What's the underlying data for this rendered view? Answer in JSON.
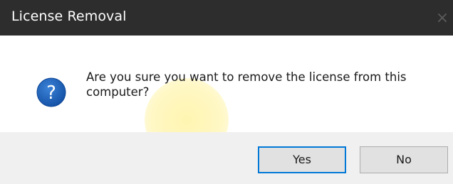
{
  "window": {
    "title": "License Removal",
    "close_glyph": "×"
  },
  "message": {
    "icon": "question-icon",
    "text": "Are you sure you want to remove the license from this computer?"
  },
  "buttons": {
    "yes_label": "Yes",
    "no_label": "No"
  },
  "colors": {
    "titlebar": "#2d2d2d",
    "icon_blue": "#1e5fb8",
    "default_button_border": "#0078d7",
    "footer": "#f0f0f0"
  }
}
